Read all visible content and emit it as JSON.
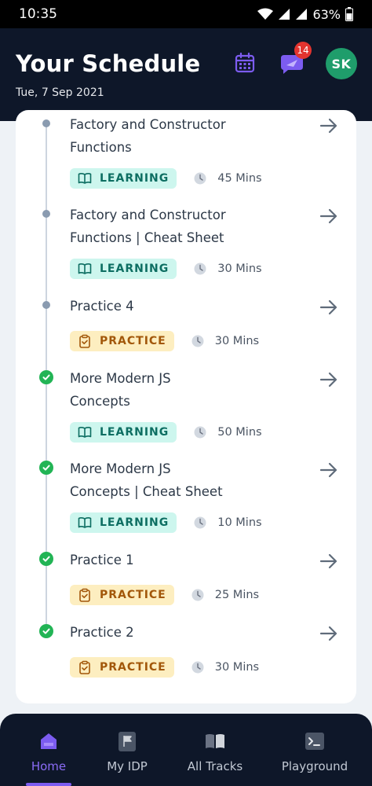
{
  "status_bar": {
    "time": "10:35",
    "battery": "63%"
  },
  "header": {
    "title": "Your Schedule",
    "date": "Tue, 7 Sep 2021",
    "notification_count": "14",
    "avatar_initials": "SK"
  },
  "items": [
    {
      "title_line1": "Factory and Constructor",
      "title_line2": "Functions",
      "tag": "LEARNING",
      "duration": "45 Mins",
      "status": "pending"
    },
    {
      "title_line1": "Factory and Constructor",
      "title_line2": "Functions | Cheat Sheet",
      "tag": "LEARNING",
      "duration": "30 Mins",
      "status": "pending"
    },
    {
      "title_line1": "Practice 4",
      "title_line2": "",
      "tag": "PRACTICE",
      "duration": "30 Mins",
      "status": "pending"
    },
    {
      "title_line1": "More Modern JS",
      "title_line2": "Concepts",
      "tag": "LEARNING",
      "duration": "50 Mins",
      "status": "done"
    },
    {
      "title_line1": "More Modern JS",
      "title_line2": "Concepts | Cheat Sheet",
      "tag": "LEARNING",
      "duration": "10 Mins",
      "status": "done"
    },
    {
      "title_line1": "Practice 1",
      "title_line2": "",
      "tag": "PRACTICE",
      "duration": "25 Mins",
      "status": "done"
    },
    {
      "title_line1": "Practice 2",
      "title_line2": "",
      "tag": "PRACTICE",
      "duration": "30 Mins",
      "status": "done"
    }
  ],
  "nav": [
    {
      "label": "Home",
      "icon": "home-icon",
      "active": true
    },
    {
      "label": "My IDP",
      "icon": "flag-doc-icon",
      "active": false
    },
    {
      "label": "All Tracks",
      "icon": "open-book-icon",
      "active": false
    },
    {
      "label": "Playground",
      "icon": "terminal-icon",
      "active": false
    }
  ],
  "colors": {
    "header_bg": "#0e1729",
    "accent": "#7c5cf0",
    "learning_bg": "#cdf6ee",
    "practice_bg": "#fdeec0",
    "done": "#22b455"
  }
}
